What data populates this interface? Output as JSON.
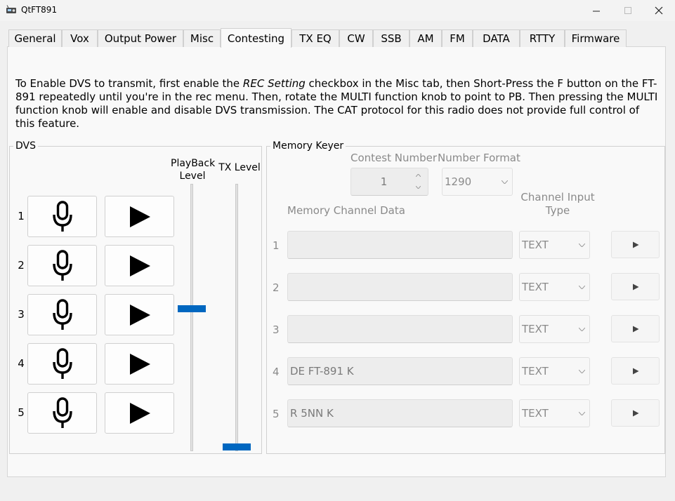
{
  "window": {
    "title": "QtFT891"
  },
  "tabs": [
    "General",
    "Vox",
    "Output Power",
    "Misc",
    "Contesting",
    "TX EQ",
    "CW",
    "SSB",
    "AM",
    "FM",
    "DATA",
    "RTTY",
    "Firmware"
  ],
  "info": {
    "part1": "To Enable DVS to transmit, first enable the ",
    "emph": "REC Setting",
    "part2": " checkbox in the Misc tab, then Short-Press the F button on the FT-891 repeatedly until you're in the rec menu. Then, rotate the MULTI function knob to point to PB. Then pressing the MULTI function knob will enable and disable DVS transmission. The CAT protocol for this radio does not provide full control of this feature."
  },
  "dvs": {
    "title": "DVS",
    "rows": [
      "1",
      "2",
      "3",
      "4",
      "5"
    ],
    "playback_label": "PlayBack Level",
    "tx_label": "TX Level",
    "playback_level": 0.53,
    "tx_level": 0.0
  },
  "keyer": {
    "title": "Memory Keyer",
    "contest_number_label": "Contest Number",
    "contest_number": "1",
    "number_format_label": "Number Format",
    "number_format": "1290",
    "channel_data_label": "Memory Channel Data",
    "channel_type_label": "Channel Input Type",
    "channels": [
      {
        "num": "1",
        "value": "",
        "type": "TEXT"
      },
      {
        "num": "2",
        "value": "",
        "type": "TEXT"
      },
      {
        "num": "3",
        "value": "",
        "type": "TEXT"
      },
      {
        "num": "4",
        "value": "DE FT-891 K",
        "type": "TEXT"
      },
      {
        "num": "5",
        "value": "R 5NN K",
        "type": "TEXT"
      }
    ]
  },
  "colors": {
    "accent": "#0067c0"
  }
}
